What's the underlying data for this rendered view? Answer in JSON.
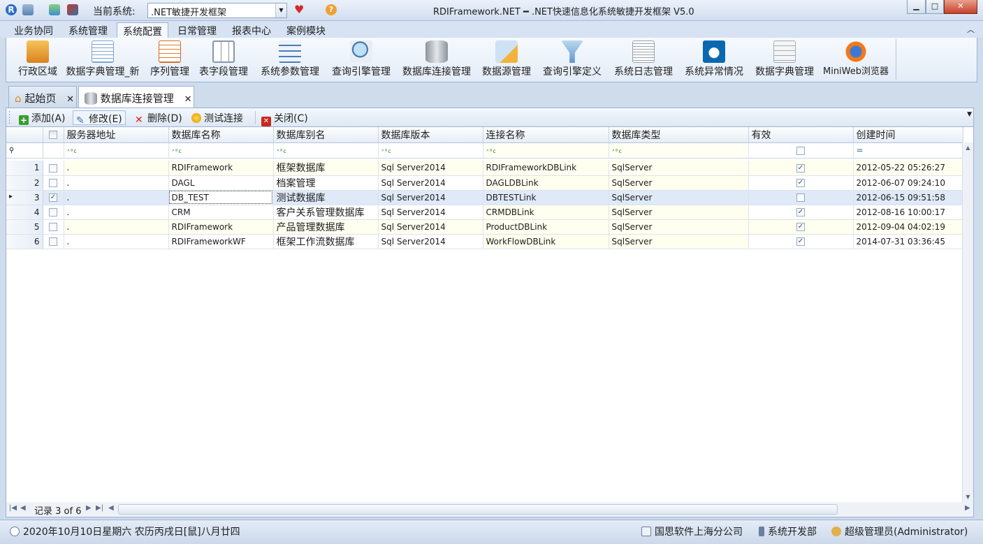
{
  "app": {
    "system_label": "当前系统:",
    "system_value": ".NET敏捷开发框架",
    "window_title": "RDIFramework.NET ━ .NET快速信息化系统敏捷开发框架 V5.0"
  },
  "menu_tabs": [
    "业务协同",
    "系统管理",
    "系统配置",
    "日常管理",
    "报表中心",
    "案例模块"
  ],
  "active_menu_tab": "系统配置",
  "ribbon": [
    {
      "label": "行政区域",
      "icon": "region-icon"
    },
    {
      "label": "数据字典管理_新",
      "icon": "dictionary-icon"
    },
    {
      "label": "序列管理",
      "icon": "sequence-icon"
    },
    {
      "label": "表字段管理",
      "icon": "table-field-icon"
    },
    {
      "label": "系统参数管理",
      "icon": "parameter-icon"
    },
    {
      "label": "查询引擎管理",
      "icon": "query-engine-icon"
    },
    {
      "label": "数据库连接管理",
      "icon": "database-icon"
    },
    {
      "label": "数据源管理",
      "icon": "datasource-icon"
    },
    {
      "label": "查询引擎定义",
      "icon": "filter-icon"
    },
    {
      "label": "系统日志管理",
      "icon": "log-icon"
    },
    {
      "label": "系统异常情况",
      "icon": "exception-icon"
    },
    {
      "label": "数据字典管理",
      "icon": "dictionary-table-icon"
    },
    {
      "label": "MiniWeb浏览器",
      "icon": "browser-icon"
    }
  ],
  "doc_tabs": [
    {
      "label": "起始页",
      "icon": "home-icon"
    },
    {
      "label": "数据库连接管理",
      "icon": "database-icon"
    }
  ],
  "toolbar": {
    "add": "添加(A)",
    "edit": "修改(E)",
    "delete": "删除(D)",
    "test": "测试连接",
    "close": "关闭(C)"
  },
  "grid": {
    "columns": [
      "服务器地址",
      "数据库名称",
      "数据库别名",
      "数据库版本",
      "连接名称",
      "数据库类型",
      "有效",
      "创建时间"
    ],
    "filter_equals": "=",
    "rows": [
      {
        "no": "1",
        "checked": false,
        "server": ".",
        "db_name": "RDIFramework",
        "alias": "框架数据库",
        "version": "Sql Server2014",
        "conn": "RDIFrameworkDBLink",
        "type": "SqlServer",
        "valid": true,
        "created": "2012-05-22 05:26:27"
      },
      {
        "no": "2",
        "checked": false,
        "server": ".",
        "db_name": "DAGL",
        "alias": "档案管理",
        "version": "Sql Server2014",
        "conn": "DAGLDBLink",
        "type": "SqlServer",
        "valid": true,
        "created": "2012-06-07 09:24:10"
      },
      {
        "no": "3",
        "checked": true,
        "server": ".",
        "db_name": "DB_TEST",
        "alias": "测试数据库",
        "version": "Sql Server2014",
        "conn": "DBTESTLink",
        "type": "SqlServer",
        "valid": false,
        "created": "2012-06-15 09:51:58"
      },
      {
        "no": "4",
        "checked": false,
        "server": ".",
        "db_name": "CRM",
        "alias": "客户关系管理数据库",
        "version": "Sql Server2014",
        "conn": "CRMDBLink",
        "type": "SqlServer",
        "valid": true,
        "created": "2012-08-16 10:00:17"
      },
      {
        "no": "5",
        "checked": false,
        "server": ".",
        "db_name": "RDIFramework",
        "alias": "产品管理数据库",
        "version": "Sql Server2014",
        "conn": "ProductDBLink",
        "type": "SqlServer",
        "valid": true,
        "created": "2012-09-04 04:02:19"
      },
      {
        "no": "6",
        "checked": false,
        "server": ".",
        "db_name": "RDIFrameworkWF",
        "alias": "框架工作流数据库",
        "version": "Sql Server2014",
        "conn": "WorkFlowDBLink",
        "type": "SqlServer",
        "valid": true,
        "created": "2014-07-31 03:36:45"
      }
    ],
    "record_nav": "记录 3 of 6"
  },
  "status": {
    "date": "2020年10月10日星期六 农历丙戌日[鼠]八月廿四",
    "company": "国思软件上海分公司",
    "department": "系统开发部",
    "user": "超级管理员(Administrator)"
  },
  "colors": {
    "accent": "#3a6ea5",
    "row_highlight": "#fffff0",
    "selected_row": "#dfe9f7"
  }
}
